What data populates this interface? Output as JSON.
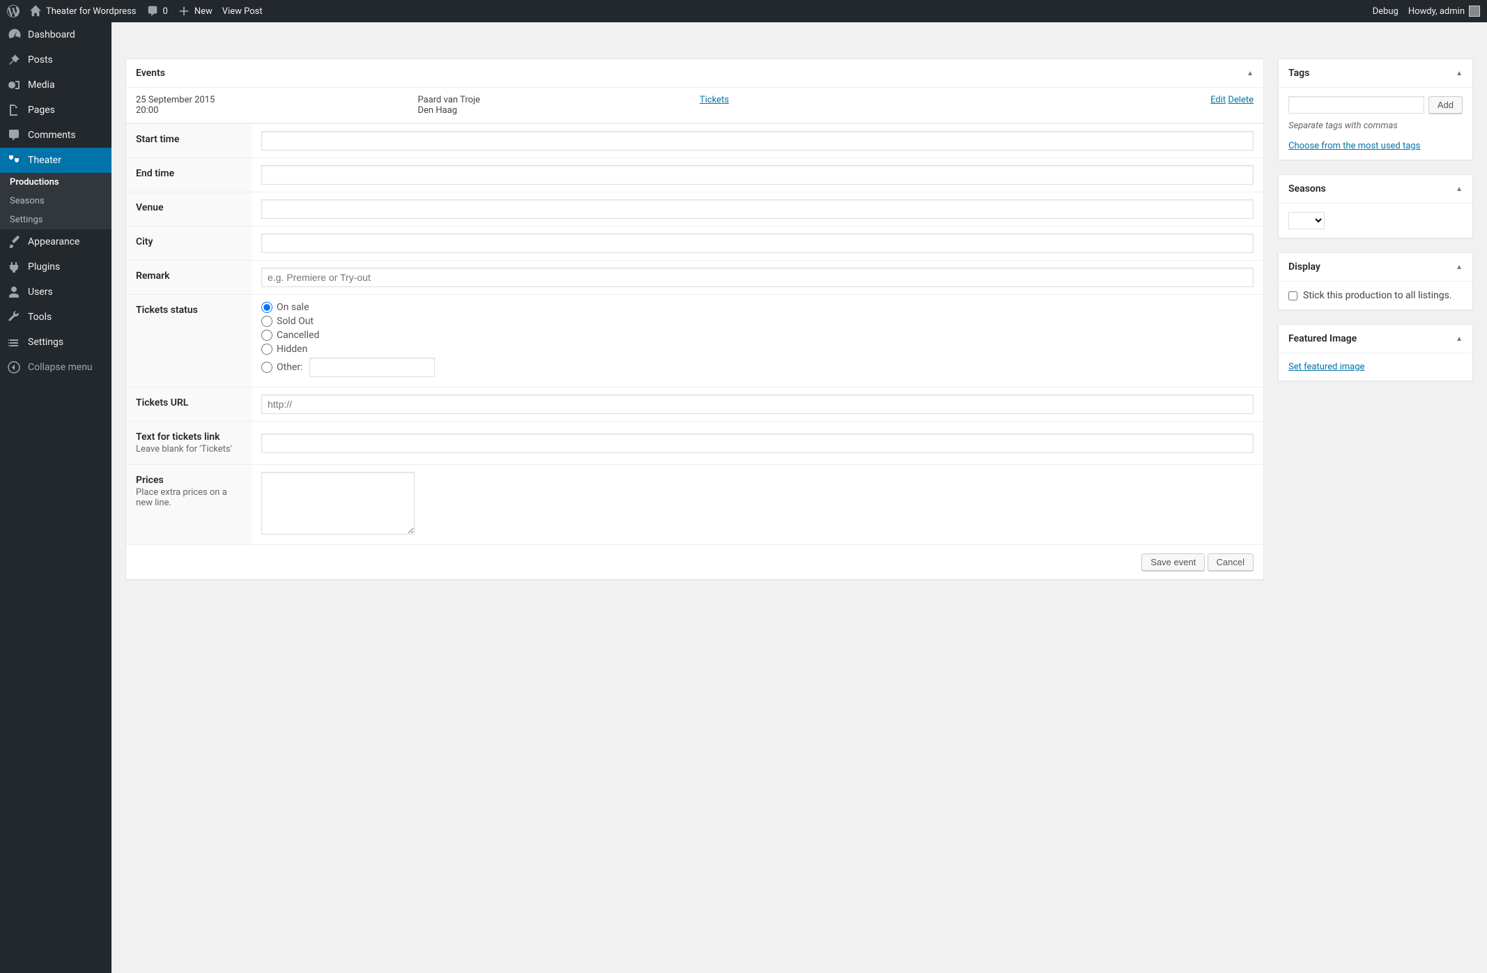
{
  "adminbar": {
    "site_name": "Theater for Wordpress",
    "comments_count": "0",
    "new_label": "New",
    "view_post_label": "View Post",
    "debug_label": "Debug",
    "howdy_label": "Howdy, admin"
  },
  "sidebar": {
    "dashboard": "Dashboard",
    "posts": "Posts",
    "media": "Media",
    "pages": "Pages",
    "comments": "Comments",
    "theater": "Theater",
    "theater_sub": {
      "productions": "Productions",
      "seasons": "Seasons",
      "settings": "Settings"
    },
    "appearance": "Appearance",
    "plugins": "Plugins",
    "users": "Users",
    "tools": "Tools",
    "settings": "Settings",
    "collapse": "Collapse menu"
  },
  "events_box": {
    "title": "Events",
    "row": {
      "date": "25 September 2015",
      "time": "20:00",
      "venue": "Paard van Troje",
      "city": "Den Haag",
      "tickets_link": "Tickets",
      "edit_link": "Edit",
      "delete_link": "Delete"
    },
    "fields": {
      "start_time": "Start time",
      "end_time": "End time",
      "venue": "Venue",
      "city": "City",
      "remark": "Remark",
      "remark_placeholder": "e.g. Premiere or Try-out",
      "tickets_status": "Tickets status",
      "status_options": {
        "on_sale": "On sale",
        "sold_out": "Sold Out",
        "cancelled": "Cancelled",
        "hidden": "Hidden",
        "other": "Other:"
      },
      "tickets_url": "Tickets URL",
      "tickets_url_placeholder": "http://",
      "text_link": "Text for tickets link",
      "text_link_desc": "Leave blank for 'Tickets'",
      "prices": "Prices",
      "prices_desc": "Place extra prices on a new line."
    },
    "save_button": "Save event",
    "cancel_button": "Cancel"
  },
  "tags_box": {
    "title": "Tags",
    "add_button": "Add",
    "howto": "Separate tags with commas",
    "choose_link": "Choose from the most used tags"
  },
  "seasons_box": {
    "title": "Seasons"
  },
  "display_box": {
    "title": "Display",
    "stick_label": "Stick this production to all listings."
  },
  "featured_box": {
    "title": "Featured Image",
    "set_link": "Set featured image"
  }
}
